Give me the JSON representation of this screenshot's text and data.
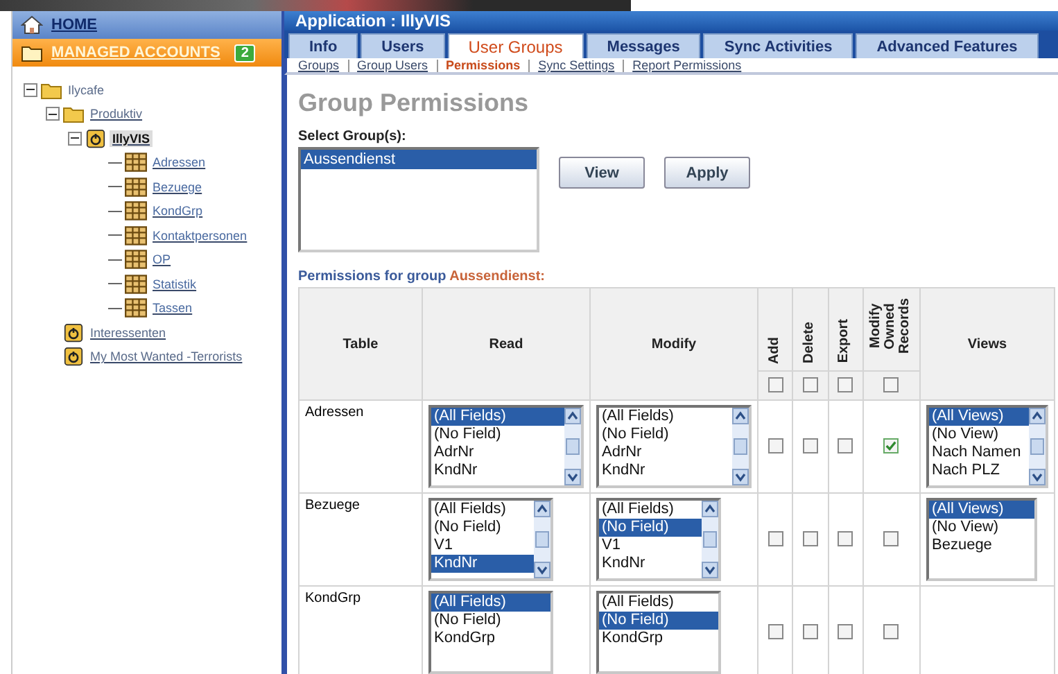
{
  "sidebar": {
    "home": "HOME",
    "managed_accounts": {
      "label": "MANAGED ACCOUNTS",
      "count": "2"
    },
    "tree": [
      {
        "label": "Ilycafe",
        "kind": "folder",
        "expanded": true,
        "selected": false,
        "children": [
          {
            "label": "Produktiv",
            "kind": "folder",
            "expanded": true,
            "selected": false,
            "children": [
              {
                "label": "IllyVIS",
                "kind": "database",
                "expanded": true,
                "selected": true,
                "children": [
                  {
                    "label": "Adressen",
                    "kind": "table",
                    "selected": false
                  },
                  {
                    "label": "Bezuege",
                    "kind": "table",
                    "selected": false
                  },
                  {
                    "label": "KondGrp",
                    "kind": "table",
                    "selected": false
                  },
                  {
                    "label": "Kontaktpersonen",
                    "kind": "table",
                    "selected": false
                  },
                  {
                    "label": "OP",
                    "kind": "table",
                    "selected": false
                  },
                  {
                    "label": "Statistik",
                    "kind": "table",
                    "selected": false
                  },
                  {
                    "label": "Tassen",
                    "kind": "table",
                    "selected": false
                  }
                ]
              }
            ]
          },
          {
            "label": "Interessenten",
            "kind": "database",
            "selected": false
          },
          {
            "label": "My Most Wanted -Terrorists",
            "kind": "database",
            "selected": false
          }
        ]
      }
    ]
  },
  "app": {
    "title": "Application : IllyVIS",
    "tabs": [
      {
        "label": "Info",
        "selected": false
      },
      {
        "label": "Users",
        "selected": false
      },
      {
        "label": "User Groups",
        "selected": true
      },
      {
        "label": "Messages",
        "selected": false
      },
      {
        "label": "Sync Activities",
        "selected": false
      },
      {
        "label": "Advanced Features",
        "selected": false
      }
    ],
    "subtabs": [
      {
        "label": "Groups",
        "selected": false
      },
      {
        "label": "Group Users",
        "selected": false
      },
      {
        "label": "Permissions",
        "selected": true
      },
      {
        "label": "Sync Settings",
        "selected": false
      },
      {
        "label": "Report Permissions",
        "selected": false
      }
    ],
    "heading": "Group Permissions",
    "select_label": "Select Group(s):",
    "groups": [
      {
        "label": "Aussendienst",
        "selected": true
      }
    ],
    "buttons": [
      "View",
      "Apply"
    ],
    "permissions_caption": {
      "text": "Permissions for group",
      "group": "Aussendienst:"
    },
    "table": {
      "columns": [
        "Table",
        "Read",
        "Modify",
        "Add",
        "Delete",
        "Export",
        "Modify Owned Records",
        "Views"
      ],
      "header_checkboxes": [
        {
          "checked": false
        },
        {
          "checked": false
        },
        {
          "checked": false
        },
        {
          "checked": false
        }
      ],
      "rows": [
        {
          "table": "Adressen",
          "read": {
            "scrollbar": true,
            "items": [
              {
                "label": "(All Fields)",
                "selected": true
              },
              {
                "label": "(No Field)",
                "selected": false
              },
              {
                "label": "AdrNr",
                "selected": false
              },
              {
                "label": "KndNr",
                "selected": false
              }
            ]
          },
          "modify": {
            "scrollbar": true,
            "items": [
              {
                "label": "(All Fields)",
                "selected": false
              },
              {
                "label": "(No Field)",
                "selected": false
              },
              {
                "label": "AdrNr",
                "selected": false
              },
              {
                "label": "KndNr",
                "selected": false
              }
            ]
          },
          "flags": [
            {
              "checked": false
            },
            {
              "checked": false
            },
            {
              "checked": false
            },
            {
              "checked": true
            }
          ],
          "views": {
            "scrollbar": true,
            "items": [
              {
                "label": "(All Views)",
                "selected": true
              },
              {
                "label": "(No View)",
                "selected": false
              },
              {
                "label": "Nach Namen",
                "selected": false
              },
              {
                "label": "Nach PLZ",
                "selected": false
              }
            ]
          }
        },
        {
          "table": "Bezuege",
          "read": {
            "scrollbar": true,
            "items": [
              {
                "label": "(All Fields)",
                "selected": false
              },
              {
                "label": "(No Field)",
                "selected": false
              },
              {
                "label": "V1",
                "selected": false
              },
              {
                "label": "KndNr",
                "selected": true
              }
            ]
          },
          "modify": {
            "scrollbar": true,
            "items": [
              {
                "label": "(All Fields)",
                "selected": false
              },
              {
                "label": "(No Field)",
                "selected": true
              },
              {
                "label": "V1",
                "selected": false
              },
              {
                "label": "KndNr",
                "selected": false
              }
            ]
          },
          "flags": [
            {
              "checked": false
            },
            {
              "checked": false
            },
            {
              "checked": false
            },
            {
              "checked": false
            }
          ],
          "views": {
            "scrollbar": false,
            "items": [
              {
                "label": "(All Views)",
                "selected": true
              },
              {
                "label": "(No View)",
                "selected": false
              },
              {
                "label": "Bezuege",
                "selected": false
              }
            ]
          }
        },
        {
          "table": "KondGrp",
          "read": {
            "scrollbar": false,
            "items": [
              {
                "label": "(All Fields)",
                "selected": true
              },
              {
                "label": "(No Field)",
                "selected": false
              },
              {
                "label": "KondGrp",
                "selected": false
              }
            ]
          },
          "modify": {
            "scrollbar": false,
            "items": [
              {
                "label": "(All Fields)",
                "selected": false
              },
              {
                "label": "(No Field)",
                "selected": true
              },
              {
                "label": "KondGrp",
                "selected": false
              }
            ]
          },
          "flags": [
            {
              "checked": false
            },
            {
              "checked": false
            },
            {
              "checked": false
            },
            {
              "checked": false
            }
          ]
        }
      ]
    }
  }
}
